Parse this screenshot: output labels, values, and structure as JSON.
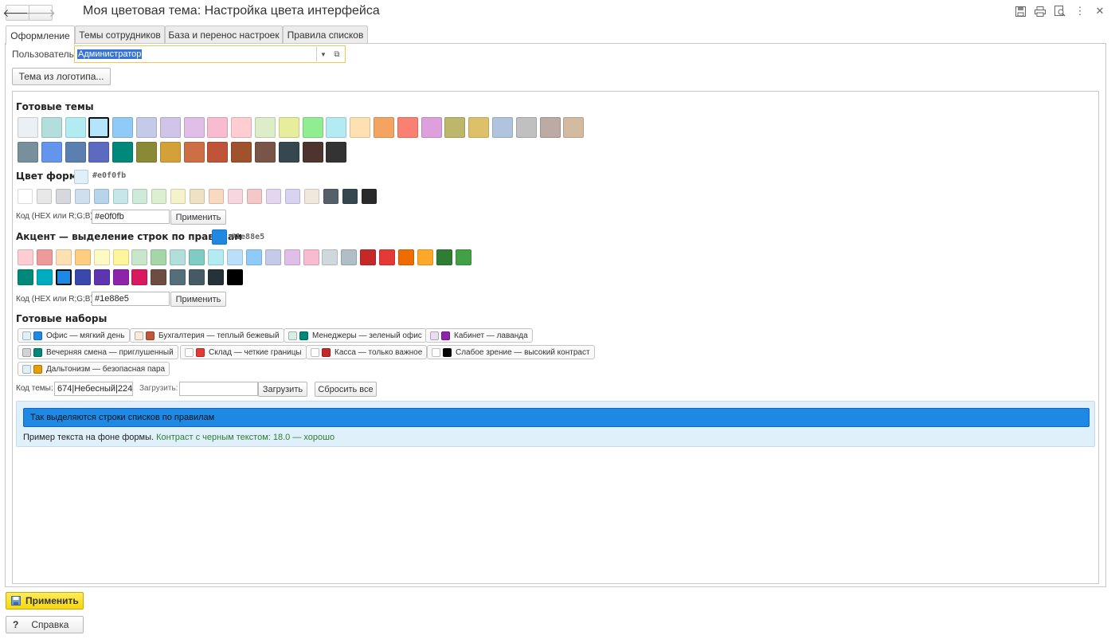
{
  "header": {
    "back_icon": "arrow-left-icon",
    "forward_icon": "arrow-right-icon",
    "title": "Моя цветовая тема: Настройка цвета интерфейса",
    "icons": [
      "save-icon",
      "print-icon",
      "preview-icon",
      "more-icon",
      "close-icon"
    ]
  },
  "tabs": [
    "Оформление",
    "Темы сотрудников",
    "База и перенос настроек",
    "Правила списков"
  ],
  "user": {
    "label": "Пользователь:",
    "value": "Администратор"
  },
  "logo_theme_button": "Тема из логотипа...",
  "ready_themes": {
    "title": "Готовые темы",
    "row1": [
      "#eceff4",
      "#b2dfdb",
      "#b2ebf2",
      "#b3e5fc",
      "#90caf9",
      "#c5cae9",
      "#d1c4e9",
      "#e1bee7",
      "#f8bbd0",
      "#ffcdd2",
      "#dcedc8",
      "#e6ee9c",
      "#90ee90",
      "#b2ebf2",
      "#ffe0b2",
      "#f4a460",
      "#fa8072",
      "#dda0dd",
      "#bdb76b",
      "#dec06b",
      "#b0c4de",
      "#c0c0c0",
      "#bcaaa4",
      "#d2bba0"
    ],
    "row2": [
      "#78909c",
      "#6495ed",
      "#5b7fae",
      "#5c6bc0",
      "#00897b",
      "#8a8a36",
      "#d4a038",
      "#cd6e44",
      "#bf5438",
      "#a0522d",
      "#795548",
      "#37474f",
      "#4e342e",
      "#333333"
    ],
    "selected_index": 3
  },
  "form_color": {
    "title": "Цвет форм",
    "current": "#e0f0fb",
    "hex_text": "#e0f0fb",
    "swatches": [
      "#ffffff",
      "#e8e8e8",
      "#d5d8dc",
      "#cfdfee",
      "#b8d4ec",
      "#c6e6ea",
      "#cdebd8",
      "#dcefd0",
      "#f6f2cc",
      "#efe2c4",
      "#f9d9c0",
      "#f8d6df",
      "#f4c8c8",
      "#e3d7f0",
      "#d9d3f2",
      "#efe8dc",
      "#55606a",
      "#37474f",
      "#2a2a2a"
    ],
    "code_label": "Код (HEX или R;G;B):",
    "code_value": "#e0f0fb",
    "apply_label": "Применить"
  },
  "accent": {
    "title": "Акцент — выделение строк по правилам",
    "current": "#1e88e5",
    "hex_text": "#1e88e5",
    "row1": [
      "#ffcdd2",
      "#ef9a9a",
      "#ffe0b2",
      "#ffcc80",
      "#fff9c4",
      "#fff59d",
      "#c8e6c9",
      "#a5d6a7",
      "#b2dfdb",
      "#80cbc4",
      "#b2ebf2",
      "#bbdefb",
      "#90caf9",
      "#c5cae9",
      "#e1bee7",
      "#f8bbd0",
      "#cfd8dc",
      "#b0bec5",
      "#c62828",
      "#e53935",
      "#ef6c00",
      "#ffa726",
      "#2e7d32",
      "#43a047"
    ],
    "row2": [
      "#00897b",
      "#00acc1",
      "#1e88e5",
      "#3949ab",
      "#5e35b1",
      "#8e24aa",
      "#d81b60",
      "#6d4c41",
      "#546e7a",
      "#455a64",
      "#263238",
      "#000000"
    ],
    "selected_row2_index": 2,
    "code_label": "Код (HEX или R;G;B):",
    "code_value": "#1e88e5",
    "apply_label": "Применить"
  },
  "presets": {
    "title": "Готовые наборы",
    "items": [
      {
        "label": "Офис — мягкий день",
        "c1": "#e0f0fb",
        "c2": "#1e88e5"
      },
      {
        "label": "Бухгалтерия — теплый бежевый",
        "c1": "#f8ecd8",
        "c2": "#c0583a"
      },
      {
        "label": "Менеджеры — зеленый офис",
        "c1": "#d8eee2",
        "c2": "#00897b"
      },
      {
        "label": "Кабинет — лаванда",
        "c1": "#e8ddf2",
        "c2": "#8e24aa"
      },
      {
        "label": "Вечерняя смена — приглушенный",
        "c1": "#cfd4d8",
        "c2": "#00897b"
      },
      {
        "label": "Склад — четкие границы",
        "c1": "#ffffff",
        "c2": "#e53935"
      },
      {
        "label": "Касса — только важное",
        "c1": "#ffffff",
        "c2": "#c62828"
      },
      {
        "label": "Слабое зрение — высокий контраст",
        "c1": "#ffffff",
        "c2": "#000000"
      },
      {
        "label": "Дальтонизм — безопасная пара",
        "c1": "#e0f0fb",
        "c2": "#e69f00"
      }
    ]
  },
  "theme_code": {
    "label": "Код темы:",
    "value": "674|Небесный|224",
    "load_label": "Загрузить:",
    "load_value": "",
    "load_button": "Загрузить",
    "reset_button": "Сбросить все"
  },
  "preview": {
    "accent_text": "Так выделяются строки списков по правилам",
    "sample_text": "Пример текста на фоне формы.",
    "contrast_text": "Контраст с черным текстом: 18.0 — хорошо",
    "contrast_color": "#2e7d32"
  },
  "footer": {
    "apply_label": "Применить",
    "help_label": "Справка",
    "help_glyph": "?"
  }
}
